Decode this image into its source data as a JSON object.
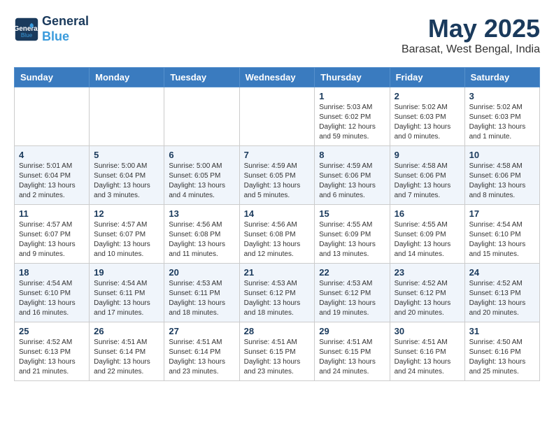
{
  "header": {
    "logo_line1": "General",
    "logo_line2": "Blue",
    "month": "May 2025",
    "location": "Barasat, West Bengal, India"
  },
  "weekdays": [
    "Sunday",
    "Monday",
    "Tuesday",
    "Wednesday",
    "Thursday",
    "Friday",
    "Saturday"
  ],
  "weeks": [
    [
      {
        "day": "",
        "content": ""
      },
      {
        "day": "",
        "content": ""
      },
      {
        "day": "",
        "content": ""
      },
      {
        "day": "",
        "content": ""
      },
      {
        "day": "1",
        "content": "Sunrise: 5:03 AM\nSunset: 6:02 PM\nDaylight: 12 hours\nand 59 minutes."
      },
      {
        "day": "2",
        "content": "Sunrise: 5:02 AM\nSunset: 6:03 PM\nDaylight: 13 hours\nand 0 minutes."
      },
      {
        "day": "3",
        "content": "Sunrise: 5:02 AM\nSunset: 6:03 PM\nDaylight: 13 hours\nand 1 minute."
      }
    ],
    [
      {
        "day": "4",
        "content": "Sunrise: 5:01 AM\nSunset: 6:04 PM\nDaylight: 13 hours\nand 2 minutes."
      },
      {
        "day": "5",
        "content": "Sunrise: 5:00 AM\nSunset: 6:04 PM\nDaylight: 13 hours\nand 3 minutes."
      },
      {
        "day": "6",
        "content": "Sunrise: 5:00 AM\nSunset: 6:05 PM\nDaylight: 13 hours\nand 4 minutes."
      },
      {
        "day": "7",
        "content": "Sunrise: 4:59 AM\nSunset: 6:05 PM\nDaylight: 13 hours\nand 5 minutes."
      },
      {
        "day": "8",
        "content": "Sunrise: 4:59 AM\nSunset: 6:06 PM\nDaylight: 13 hours\nand 6 minutes."
      },
      {
        "day": "9",
        "content": "Sunrise: 4:58 AM\nSunset: 6:06 PM\nDaylight: 13 hours\nand 7 minutes."
      },
      {
        "day": "10",
        "content": "Sunrise: 4:58 AM\nSunset: 6:06 PM\nDaylight: 13 hours\nand 8 minutes."
      }
    ],
    [
      {
        "day": "11",
        "content": "Sunrise: 4:57 AM\nSunset: 6:07 PM\nDaylight: 13 hours\nand 9 minutes."
      },
      {
        "day": "12",
        "content": "Sunrise: 4:57 AM\nSunset: 6:07 PM\nDaylight: 13 hours\nand 10 minutes."
      },
      {
        "day": "13",
        "content": "Sunrise: 4:56 AM\nSunset: 6:08 PM\nDaylight: 13 hours\nand 11 minutes."
      },
      {
        "day": "14",
        "content": "Sunrise: 4:56 AM\nSunset: 6:08 PM\nDaylight: 13 hours\nand 12 minutes."
      },
      {
        "day": "15",
        "content": "Sunrise: 4:55 AM\nSunset: 6:09 PM\nDaylight: 13 hours\nand 13 minutes."
      },
      {
        "day": "16",
        "content": "Sunrise: 4:55 AM\nSunset: 6:09 PM\nDaylight: 13 hours\nand 14 minutes."
      },
      {
        "day": "17",
        "content": "Sunrise: 4:54 AM\nSunset: 6:10 PM\nDaylight: 13 hours\nand 15 minutes."
      }
    ],
    [
      {
        "day": "18",
        "content": "Sunrise: 4:54 AM\nSunset: 6:10 PM\nDaylight: 13 hours\nand 16 minutes."
      },
      {
        "day": "19",
        "content": "Sunrise: 4:54 AM\nSunset: 6:11 PM\nDaylight: 13 hours\nand 17 minutes."
      },
      {
        "day": "20",
        "content": "Sunrise: 4:53 AM\nSunset: 6:11 PM\nDaylight: 13 hours\nand 18 minutes."
      },
      {
        "day": "21",
        "content": "Sunrise: 4:53 AM\nSunset: 6:12 PM\nDaylight: 13 hours\nand 18 minutes."
      },
      {
        "day": "22",
        "content": "Sunrise: 4:53 AM\nSunset: 6:12 PM\nDaylight: 13 hours\nand 19 minutes."
      },
      {
        "day": "23",
        "content": "Sunrise: 4:52 AM\nSunset: 6:12 PM\nDaylight: 13 hours\nand 20 minutes."
      },
      {
        "day": "24",
        "content": "Sunrise: 4:52 AM\nSunset: 6:13 PM\nDaylight: 13 hours\nand 20 minutes."
      }
    ],
    [
      {
        "day": "25",
        "content": "Sunrise: 4:52 AM\nSunset: 6:13 PM\nDaylight: 13 hours\nand 21 minutes."
      },
      {
        "day": "26",
        "content": "Sunrise: 4:51 AM\nSunset: 6:14 PM\nDaylight: 13 hours\nand 22 minutes."
      },
      {
        "day": "27",
        "content": "Sunrise: 4:51 AM\nSunset: 6:14 PM\nDaylight: 13 hours\nand 23 minutes."
      },
      {
        "day": "28",
        "content": "Sunrise: 4:51 AM\nSunset: 6:15 PM\nDaylight: 13 hours\nand 23 minutes."
      },
      {
        "day": "29",
        "content": "Sunrise: 4:51 AM\nSunset: 6:15 PM\nDaylight: 13 hours\nand 24 minutes."
      },
      {
        "day": "30",
        "content": "Sunrise: 4:51 AM\nSunset: 6:16 PM\nDaylight: 13 hours\nand 24 minutes."
      },
      {
        "day": "31",
        "content": "Sunrise: 4:50 AM\nSunset: 6:16 PM\nDaylight: 13 hours\nand 25 minutes."
      }
    ]
  ]
}
